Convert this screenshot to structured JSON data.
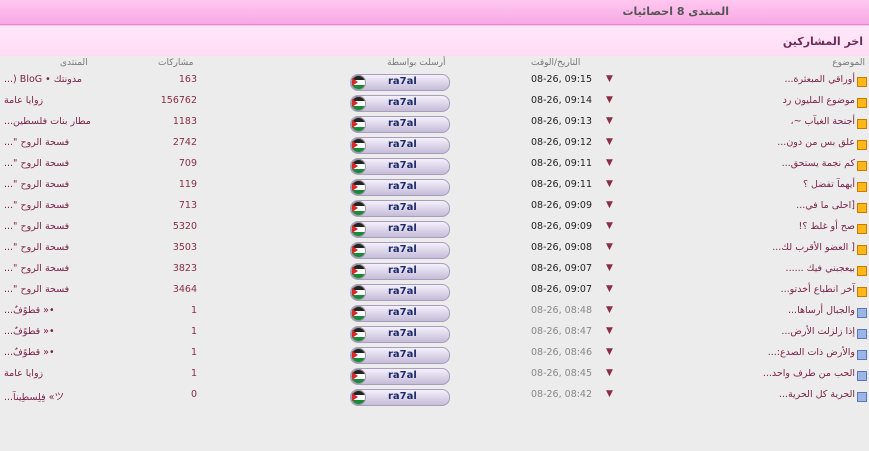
{
  "header": {
    "title": "المنتدى 8 احصائيات"
  },
  "section": {
    "title": "اخر المشاركين"
  },
  "columns": {
    "topic": "الموضوع",
    "datetime": "التاريخ/الوقت",
    "poster": "أرسلت بواسطة",
    "posts": "مشاركات",
    "forum": "المنتدى"
  },
  "rows": [
    {
      "topic": "أوراقي المبعثرة...",
      "date": "08-26, 09:15",
      "user": "ra7al",
      "posts": "163",
      "forum": "مدونتك • BloG (...",
      "hot": true
    },
    {
      "topic": "موضوع المليون رد",
      "date": "08-26, 09:14",
      "user": "ra7al",
      "posts": "156762",
      "forum": "زوايا عامة",
      "hot": true
    },
    {
      "topic": "أجنحة الغيآب ~،",
      "date": "08-26, 09:13",
      "user": "ra7al",
      "posts": "1183",
      "forum": "مطار بنات فلسطين...",
      "hot": true
    },
    {
      "topic": "علق بس من دون...",
      "date": "08-26, 09:12",
      "user": "ra7al",
      "posts": "2742",
      "forum": "فسحة الروح \"...",
      "hot": true
    },
    {
      "topic": "كم نجمة يستحق...",
      "date": "08-26, 09:11",
      "user": "ra7al",
      "posts": "709",
      "forum": "فسحة الروح \"...",
      "hot": true
    },
    {
      "topic": "أيهمآ تفضل ؟",
      "date": "08-26, 09:11",
      "user": "ra7al",
      "posts": "119",
      "forum": "فسحة الروح \"...",
      "hot": true
    },
    {
      "topic": "[احلى ما في...",
      "date": "08-26, 09:09",
      "user": "ra7al",
      "posts": "713",
      "forum": "فسحة الروح \"...",
      "hot": true
    },
    {
      "topic": "صح أو غلط ؟!",
      "date": "08-26, 09:09",
      "user": "ra7al",
      "posts": "5320",
      "forum": "فسحة الروح \"...",
      "hot": true
    },
    {
      "topic": "[ العضو الأقرب لك...",
      "date": "08-26, 09:08",
      "user": "ra7al",
      "posts": "3503",
      "forum": "فسحة الروح \"...",
      "hot": true
    },
    {
      "topic": "بيعجبني فيك ......",
      "date": "08-26, 09:07",
      "user": "ra7al",
      "posts": "3823",
      "forum": "فسحة الروح \"...",
      "hot": true
    },
    {
      "topic": "آخر انطباع أخدتو...",
      "date": "08-26, 09:07",
      "user": "ra7al",
      "posts": "3464",
      "forum": "فسحة الروح \"...",
      "hot": true
    },
    {
      "topic": "والجبال أرساها...",
      "date": "08-26, 08:48",
      "user": "ra7al",
      "posts": "1",
      "forum": "•« قطوًفٌ...",
      "hot": false
    },
    {
      "topic": "إذا زلزلت الأرض...",
      "date": "08-26, 08:47",
      "user": "ra7al",
      "posts": "1",
      "forum": "•« قطوًفٌ...",
      "hot": false
    },
    {
      "topic": "والأرض ذات الصدع:...",
      "date": "08-26, 08:46",
      "user": "ra7al",
      "posts": "1",
      "forum": "•« قطوًفٌ...",
      "hot": false
    },
    {
      "topic": "الحب من طرف واحد...",
      "date": "08-26, 08:45",
      "user": "ra7al",
      "posts": "1",
      "forum": "زوايا عامة",
      "hot": false
    },
    {
      "topic": "الحرية كل الحرية...",
      "date": "08-26, 08:42",
      "user": "ra7al",
      "posts": "0",
      "forum": "ツ» فِلِسطِينآ...",
      "hot": false
    }
  ]
}
